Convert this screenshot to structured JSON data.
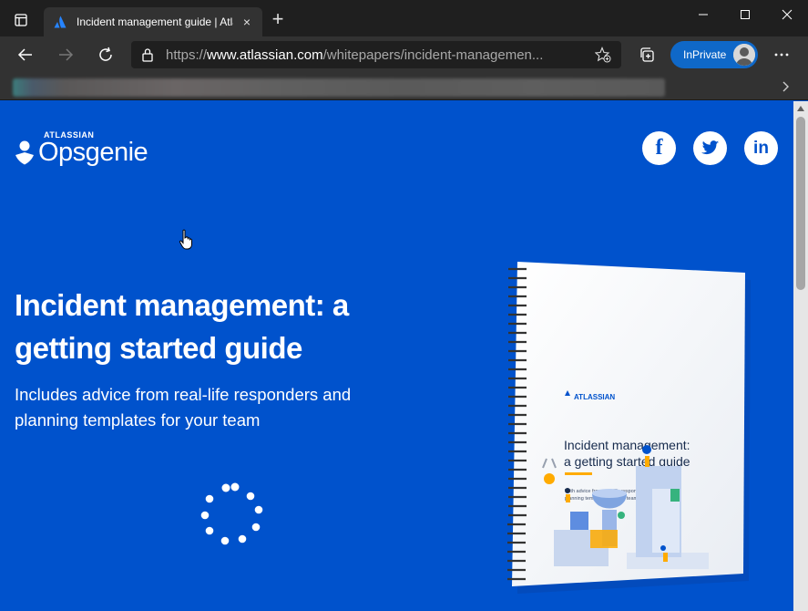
{
  "browser": {
    "tab": {
      "title": "Incident management guide | Atlassian",
      "close_label": "×"
    },
    "new_tab_label": "+",
    "address": {
      "scheme": "https://",
      "host": "www.atlassian.com",
      "path": "/whitepapers/incident-managemen..."
    },
    "inprivate_label": "InPrivate",
    "icons": {
      "tab_actions": "tab-actions-icon",
      "back": "back-arrow-icon",
      "forward": "forward-arrow-icon",
      "refresh": "refresh-icon",
      "lock": "lock-icon",
      "add_favorite": "add-favorite-star-icon",
      "collections": "collections-icon",
      "more": "more-dots-icon",
      "minimize": "minimize-icon",
      "maximize": "maximize-icon",
      "close": "window-close-icon",
      "favorites_chevron": "chevron-right-icon"
    }
  },
  "page": {
    "brand": {
      "company": "ATLASSIAN",
      "product": "Opsgenie"
    },
    "social": [
      {
        "name": "facebook",
        "glyph": "f"
      },
      {
        "name": "twitter",
        "glyph": "t"
      },
      {
        "name": "linkedin",
        "glyph": "in"
      }
    ],
    "headline_line1": "Incident management: a",
    "headline_line2": "getting started guide",
    "subhead_line1": "Includes advice from real-life responders and",
    "subhead_line2": "planning templates for your team",
    "book": {
      "brand": "ATLASSIAN",
      "title_line1": "Incident management:",
      "title_line2": "a getting started guide",
      "subtitle_line1": "With advice from real-life responders and",
      "subtitle_line2": "planning templates for your team"
    },
    "loading": true
  },
  "colors": {
    "page_bg": "#0052cc",
    "tab_active": "#323232",
    "titlebar": "#1f1f1f",
    "inprivate": "#0f68c8",
    "book_accent": "#ffab00"
  }
}
